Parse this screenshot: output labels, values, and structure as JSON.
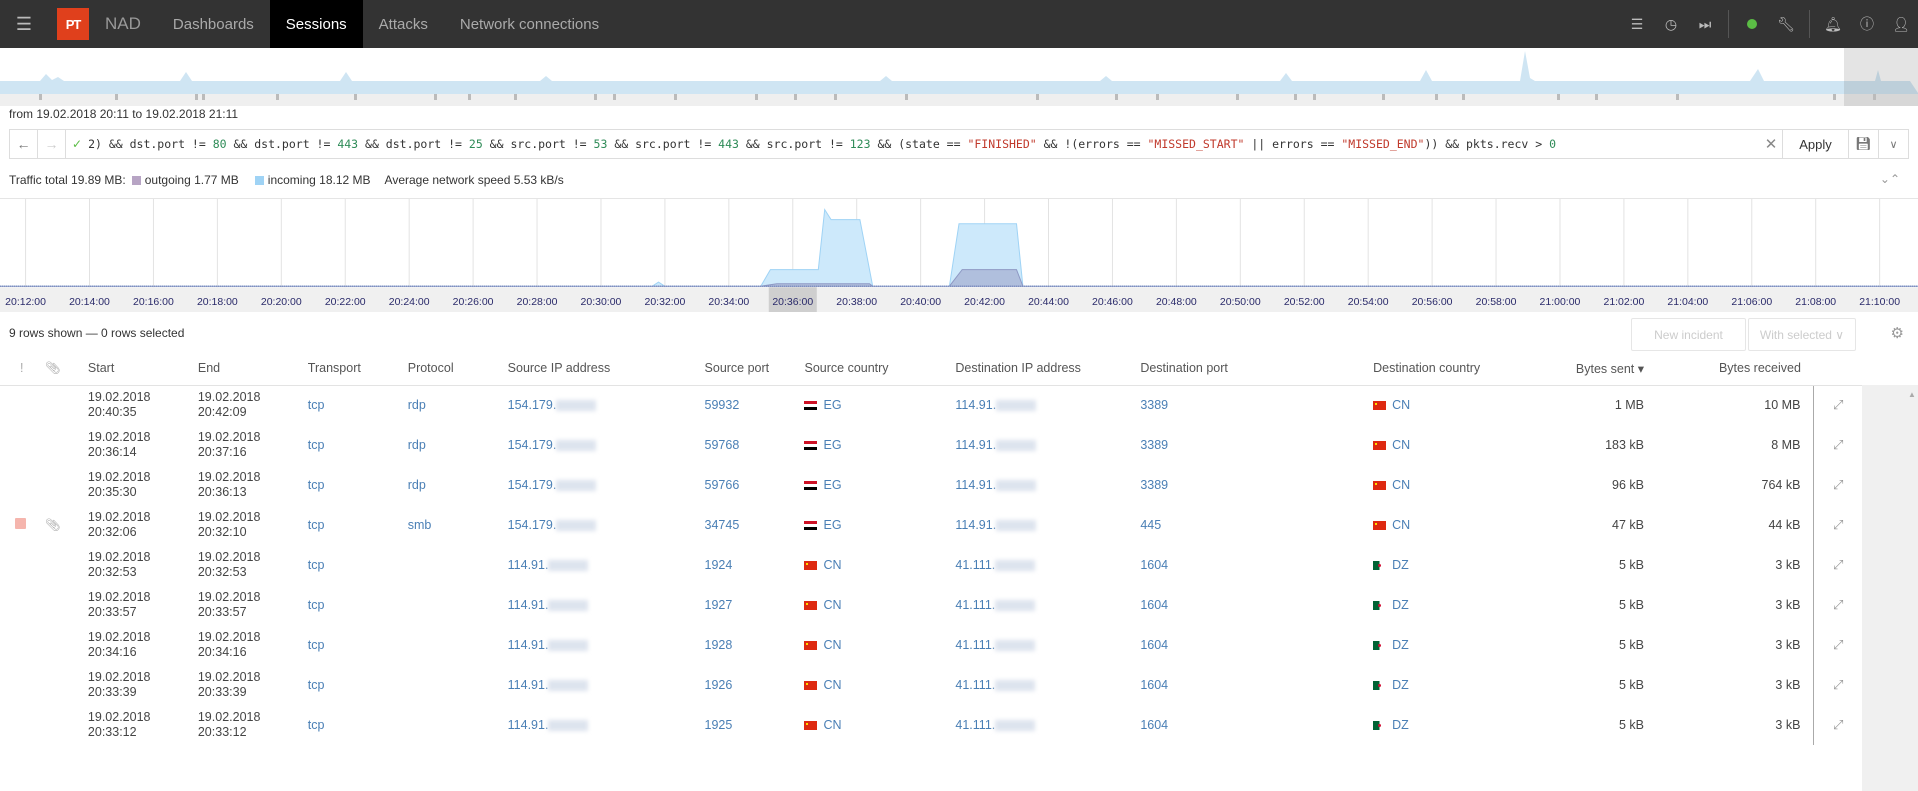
{
  "topbar": {
    "app_name": "NAD",
    "logo_text": "PT",
    "nav": [
      {
        "label": "Dashboards",
        "active": false
      },
      {
        "label": "Sessions",
        "active": true
      },
      {
        "label": "Attacks",
        "active": false
      },
      {
        "label": "Network connections",
        "active": false
      }
    ],
    "icons": [
      "list-icon",
      "clock-icon",
      "fast-forward-icon",
      "status-dot-icon",
      "wrench-icon",
      "bell-icon",
      "help-icon",
      "user-icon"
    ],
    "status_color": "#5bbd45"
  },
  "range": {
    "text": "from 19.02.2018 20:11 to 19.02.2018 21:11"
  },
  "filter": {
    "query_parts": [
      {
        "t": "2) && dst.port != ",
        "c": ""
      },
      {
        "t": "80",
        "c": "num"
      },
      {
        "t": " && dst.port != ",
        "c": ""
      },
      {
        "t": "443",
        "c": "num"
      },
      {
        "t": " && dst.port != ",
        "c": ""
      },
      {
        "t": "25",
        "c": "num"
      },
      {
        "t": " && src.port != ",
        "c": ""
      },
      {
        "t": "53",
        "c": "num"
      },
      {
        "t": " && src.port != ",
        "c": ""
      },
      {
        "t": "443",
        "c": "num"
      },
      {
        "t": " && src.port != ",
        "c": ""
      },
      {
        "t": "123",
        "c": "num"
      },
      {
        "t": " && (state == ",
        "c": ""
      },
      {
        "t": "\"FINISHED\"",
        "c": "str"
      },
      {
        "t": " && !(errors == ",
        "c": ""
      },
      {
        "t": "\"MISSED_START\"",
        "c": "str"
      },
      {
        "t": " || errors == ",
        "c": ""
      },
      {
        "t": "\"MISSED_END\"",
        "c": "str"
      },
      {
        "t": ")) && pkts.recv > ",
        "c": ""
      },
      {
        "t": "0",
        "c": "num"
      }
    ],
    "apply_label": "Apply"
  },
  "traffic": {
    "total": "Traffic total 19.89 MB:",
    "outgoing": "outgoing 1.77 MB",
    "incoming": "incoming 18.12 MB",
    "speed": "Average network speed 5.53 kB/s",
    "outgoing_color": "#b7a4c4",
    "incoming_color": "#9fd3f5"
  },
  "chart_data": {
    "type": "area",
    "title": "",
    "xlabel": "",
    "ylabel": "",
    "x_ticks": [
      "20:12:00",
      "20:14:00",
      "20:16:00",
      "20:18:00",
      "20:20:00",
      "20:22:00",
      "20:24:00",
      "20:26:00",
      "20:28:00",
      "20:30:00",
      "20:32:00",
      "20:34:00",
      "20:36:00",
      "20:38:00",
      "20:40:00",
      "20:42:00",
      "20:44:00",
      "20:46:00",
      "20:48:00",
      "20:50:00",
      "20:52:00",
      "20:54:00",
      "20:56:00",
      "20:58:00",
      "21:00:00",
      "21:02:00",
      "21:04:00",
      "21:06:00",
      "21:08:00",
      "21:10:00"
    ],
    "x_range_minutes": [
      11.2,
      71.2
    ],
    "selected_tick": "20:36:00",
    "ylim": [
      0,
      1
    ],
    "series": [
      {
        "name": "incoming",
        "points": [
          [
            11.2,
            0
          ],
          [
            31.6,
            0
          ],
          [
            31.8,
            0.05
          ],
          [
            32.0,
            0
          ],
          [
            35.0,
            0
          ],
          [
            35.3,
            0.2
          ],
          [
            36.8,
            0.2
          ],
          [
            37.0,
            0.92
          ],
          [
            37.2,
            0.8
          ],
          [
            38.1,
            0.8
          ],
          [
            38.5,
            0
          ],
          [
            40.9,
            0
          ],
          [
            41.2,
            0.75
          ],
          [
            43.0,
            0.75
          ],
          [
            43.2,
            0
          ],
          [
            71.2,
            0
          ]
        ]
      },
      {
        "name": "outgoing",
        "points": [
          [
            11.2,
            0
          ],
          [
            35.0,
            0
          ],
          [
            35.5,
            0.03
          ],
          [
            38.4,
            0.03
          ],
          [
            38.5,
            0
          ],
          [
            40.9,
            0
          ],
          [
            41.3,
            0.2
          ],
          [
            43.0,
            0.2
          ],
          [
            43.2,
            0
          ],
          [
            71.2,
            0
          ]
        ]
      }
    ]
  },
  "table": {
    "rows_info": "9 rows shown — 0 rows selected",
    "new_incident": "New incident",
    "with_selected": "With selected ∨",
    "columns": [
      "!",
      "",
      "Start",
      "End",
      "Transport",
      "Protocol",
      "Source IP address",
      "Source port",
      "Source country",
      "Destination IP address",
      "Destination port",
      "Destination country",
      "Bytes sent ▾",
      "Bytes received"
    ],
    "rows": [
      {
        "mark": false,
        "attach": false,
        "start_d": "19.02.2018",
        "start_t": "20:40:35",
        "end_d": "19.02.2018",
        "end_t": "20:42:09",
        "transport": "tcp",
        "protocol": "rdp",
        "src_ip": "154.179.",
        "src_port": "59932",
        "src_cc": "EG",
        "dst_ip": "114.91.",
        "dst_port": "3389",
        "dst_cc": "CN",
        "sent": "1 MB",
        "recv": "10 MB"
      },
      {
        "mark": false,
        "attach": false,
        "start_d": "19.02.2018",
        "start_t": "20:36:14",
        "end_d": "19.02.2018",
        "end_t": "20:37:16",
        "transport": "tcp",
        "protocol": "rdp",
        "src_ip": "154.179.",
        "src_port": "59768",
        "src_cc": "EG",
        "dst_ip": "114.91.",
        "dst_port": "3389",
        "dst_cc": "CN",
        "sent": "183 kB",
        "recv": "8 MB"
      },
      {
        "mark": false,
        "attach": false,
        "start_d": "19.02.2018",
        "start_t": "20:35:30",
        "end_d": "19.02.2018",
        "end_t": "20:36:13",
        "transport": "tcp",
        "protocol": "rdp",
        "src_ip": "154.179.",
        "src_port": "59766",
        "src_cc": "EG",
        "dst_ip": "114.91.",
        "dst_port": "3389",
        "dst_cc": "CN",
        "sent": "96 kB",
        "recv": "764 kB"
      },
      {
        "mark": true,
        "attach": true,
        "start_d": "19.02.2018",
        "start_t": "20:32:06",
        "end_d": "19.02.2018",
        "end_t": "20:32:10",
        "transport": "tcp",
        "protocol": "smb",
        "src_ip": "154.179.",
        "src_port": "34745",
        "src_cc": "EG",
        "dst_ip": "114.91.",
        "dst_port": "445",
        "dst_cc": "CN",
        "sent": "47 kB",
        "recv": "44 kB"
      },
      {
        "mark": false,
        "attach": false,
        "start_d": "19.02.2018",
        "start_t": "20:32:53",
        "end_d": "19.02.2018",
        "end_t": "20:32:53",
        "transport": "tcp",
        "protocol": "",
        "src_ip": "114.91.",
        "src_port": "1924",
        "src_cc": "CN",
        "dst_ip": "41.111.",
        "dst_port": "1604",
        "dst_cc": "DZ",
        "sent": "5 kB",
        "recv": "3 kB"
      },
      {
        "mark": false,
        "attach": false,
        "start_d": "19.02.2018",
        "start_t": "20:33:57",
        "end_d": "19.02.2018",
        "end_t": "20:33:57",
        "transport": "tcp",
        "protocol": "",
        "src_ip": "114.91.",
        "src_port": "1927",
        "src_cc": "CN",
        "dst_ip": "41.111.",
        "dst_port": "1604",
        "dst_cc": "DZ",
        "sent": "5 kB",
        "recv": "3 kB"
      },
      {
        "mark": false,
        "attach": false,
        "start_d": "19.02.2018",
        "start_t": "20:34:16",
        "end_d": "19.02.2018",
        "end_t": "20:34:16",
        "transport": "tcp",
        "protocol": "",
        "src_ip": "114.91.",
        "src_port": "1928",
        "src_cc": "CN",
        "dst_ip": "41.111.",
        "dst_port": "1604",
        "dst_cc": "DZ",
        "sent": "5 kB",
        "recv": "3 kB"
      },
      {
        "mark": false,
        "attach": false,
        "start_d": "19.02.2018",
        "start_t": "20:33:39",
        "end_d": "19.02.2018",
        "end_t": "20:33:39",
        "transport": "tcp",
        "protocol": "",
        "src_ip": "114.91.",
        "src_port": "1926",
        "src_cc": "CN",
        "dst_ip": "41.111.",
        "dst_port": "1604",
        "dst_cc": "DZ",
        "sent": "5 kB",
        "recv": "3 kB"
      },
      {
        "mark": false,
        "attach": false,
        "start_d": "19.02.2018",
        "start_t": "20:33:12",
        "end_d": "19.02.2018",
        "end_t": "20:33:12",
        "transport": "tcp",
        "protocol": "",
        "src_ip": "114.91.",
        "src_port": "1925",
        "src_cc": "CN",
        "dst_ip": "41.111.",
        "dst_port": "1604",
        "dst_cc": "DZ",
        "sent": "5 kB",
        "recv": "3 kB"
      }
    ]
  }
}
